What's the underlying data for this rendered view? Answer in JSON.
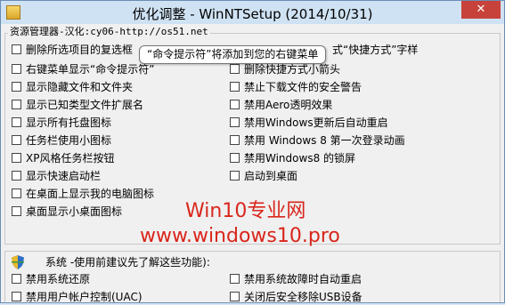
{
  "window": {
    "title": "优化调整 - WinNTSetup (2014/10/31)",
    "close_label": "✕"
  },
  "group_explorer": {
    "label": "资源管理器-汉化:cy06-http://os51.net"
  },
  "tooltip": {
    "text": "“命令提示符”将添加到您的右键菜单"
  },
  "tail_text": "式“快捷方式”字样",
  "left_items": [
    "删除所选项目的复选框",
    "右键菜单显示“命令提示符”",
    "显示隐藏文件和文件夹",
    "显示已知类型文件扩展名",
    "显示所有托盘图标",
    "任务栏使用小图标",
    "XP风格任务栏按钮",
    "显示快速启动栏",
    "在桌面上显示我的电脑图标",
    "桌面显示小桌面图标"
  ],
  "right_items": [
    "删除快捷方式小箭头",
    "禁止下载文件的安全警告",
    "禁用Aero透明效果",
    "禁用Windows更新后自动重启",
    "禁用 Windows 8 第一次登录动画",
    "禁用Windows8 的锁屏",
    "启动到桌面"
  ],
  "watermark": {
    "line1": "Win10专业网",
    "line2": "www.windows10.pro"
  },
  "system_group": {
    "label": "系统 -使用前建议先了解这些功能):",
    "left_items": [
      "禁用系统还原",
      "禁用用户帐户控制(UAC)"
    ],
    "right_items": [
      "禁用系统故障时自动重启",
      "关闭后安全移除USB设备"
    ]
  }
}
